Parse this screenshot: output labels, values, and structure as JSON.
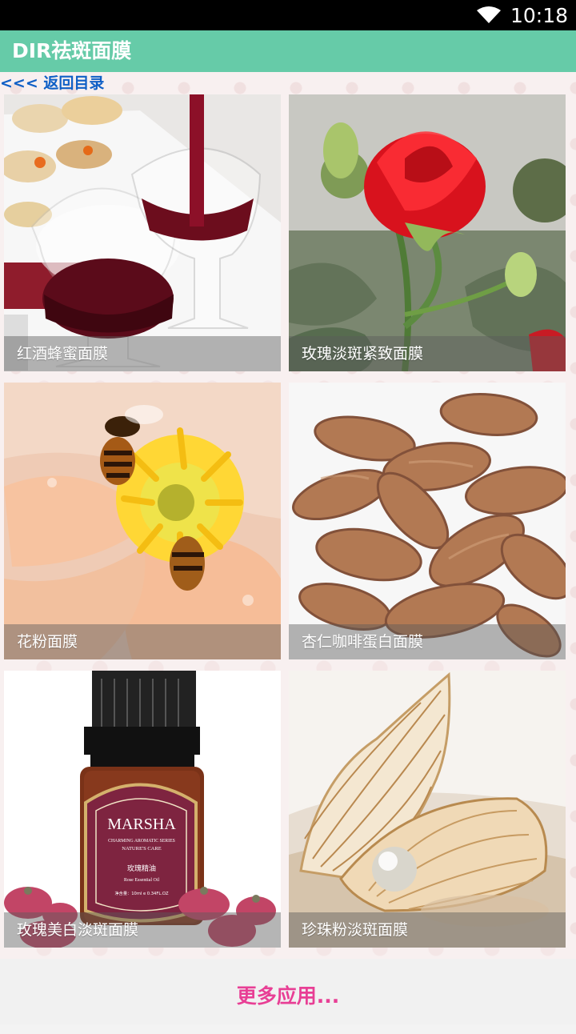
{
  "status_bar": {
    "time": "10:18",
    "wifi_icon": "wifi-icon"
  },
  "app": {
    "title": "DIR祛斑面膜"
  },
  "navigation": {
    "back_label": "<<< 返回目录"
  },
  "tiles": [
    {
      "caption": "红酒蜂蜜面膜",
      "image_icon": "red-wine-image"
    },
    {
      "caption": "玫瑰淡斑紧致面膜",
      "image_icon": "red-rose-image"
    },
    {
      "caption": "花粉面膜",
      "image_icon": "bee-flower-image"
    },
    {
      "caption": "杏仁咖啡蛋白面膜",
      "image_icon": "almonds-image"
    },
    {
      "caption": "玫瑰美白淡斑面膜",
      "image_icon": "rose-essential-oil-image"
    },
    {
      "caption": "珍珠粉淡斑面膜",
      "image_icon": "pearl-shell-image"
    }
  ],
  "product_label": {
    "brand": "MARSHA",
    "line1": "CHARMING AROMATIC SERIES",
    "line2": "NATURE'S CARE",
    "chinese": "玫瑰精油",
    "english": "Rose Essential Oil",
    "volume": "净含量：10ml e 0.34FL.OZ"
  },
  "footer": {
    "more_apps_label": "更多应用..."
  },
  "colors": {
    "title_bar": "#66cba8",
    "link": "#0f5fc6",
    "more_apps": "#e83f95"
  }
}
